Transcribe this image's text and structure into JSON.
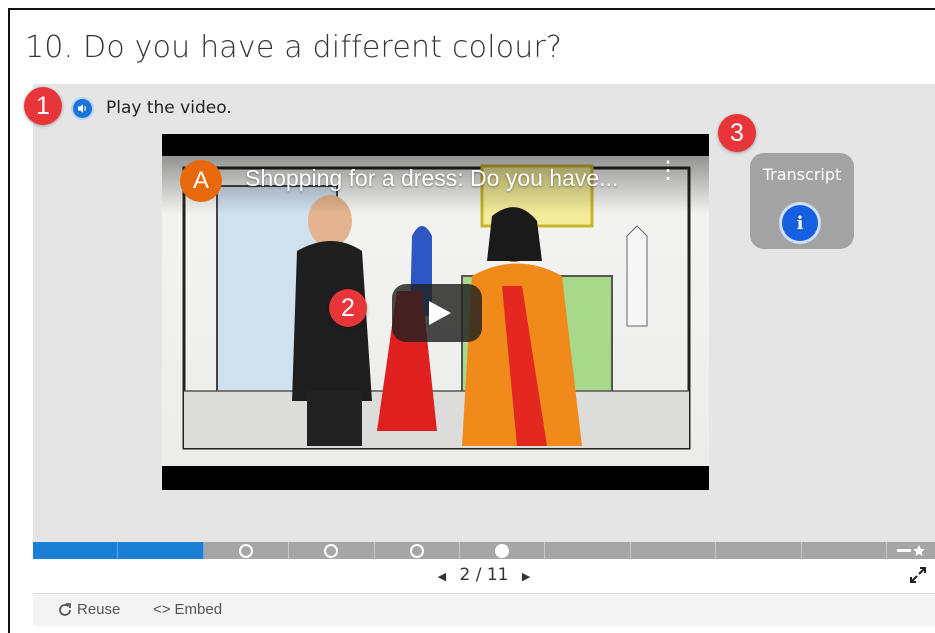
{
  "page": {
    "title": "10. Do you have a different colour?"
  },
  "instruction": {
    "text": "Play the video."
  },
  "badges": [
    "1",
    "2",
    "3"
  ],
  "video": {
    "channel_initial": "A",
    "title": "Shopping for a dress: Do you have...",
    "more_icon": "more-vert-icon"
  },
  "transcript": {
    "label": "Transcript",
    "icon": "i"
  },
  "pager": {
    "current": "2",
    "separator": "/",
    "total": "11",
    "label": "2 / 11"
  },
  "progress": {
    "segments": 11,
    "completed": 2,
    "current": 6
  },
  "footer": {
    "reuse": "Reuse",
    "embed": "Embed"
  },
  "colors": {
    "accent": "#1b7fd6",
    "badge": "#e8353a",
    "channel": "#e8690c"
  }
}
